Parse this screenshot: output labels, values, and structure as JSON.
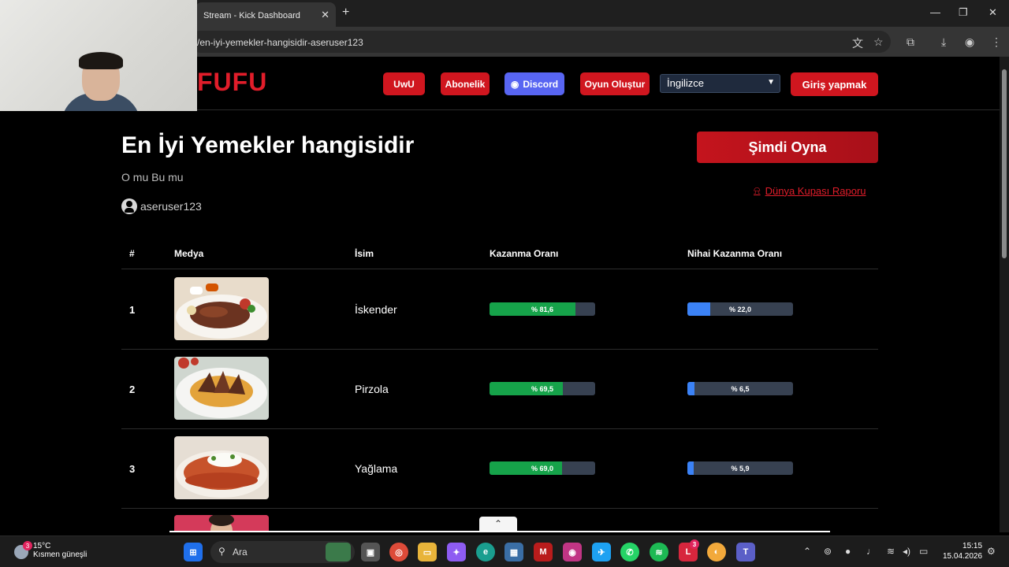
{
  "browser": {
    "tab_title": "Stream - Kick Dashboard",
    "tab_close": "✕",
    "new_tab": "+",
    "url": "/en-iyi-yemekler-hangisidir-aseruser123",
    "window_controls": [
      "—",
      "❐",
      "✕"
    ]
  },
  "nav": {
    "logo": "FUFU",
    "buttons": [
      "UwU",
      "Abonelik",
      "Discord",
      "Oyun Oluştur"
    ],
    "language": "İngilizce",
    "login": "Giriş yapmak"
  },
  "header": {
    "title": "En İyi Yemekler hangisidir",
    "subtitle": "O mu Bu mu",
    "author": "aseruser123",
    "play_button": "Şimdi Oyna",
    "report_link": "Dünya Kupası Raporu"
  },
  "table": {
    "columns": [
      "#",
      "Medya",
      "İsim",
      "Kazanma Oranı",
      "Nihai Kazanma Oranı"
    ],
    "rows": [
      {
        "rank": "1",
        "name": "İskender",
        "win_rate": 81.6,
        "win_label": "% 81,6",
        "final_rate": 22.0,
        "final_label": "% 22,0",
        "image": "iskender-plate"
      },
      {
        "rank": "2",
        "name": "Pirzola",
        "win_rate": 69.5,
        "win_label": "% 69,5",
        "final_rate": 6.5,
        "final_label": "% 6,5",
        "image": "lamb-chops-plate"
      },
      {
        "rank": "3",
        "name": "Yağlama",
        "win_rate": 69.0,
        "win_label": "% 69,0",
        "final_rate": 5.9,
        "final_label": "% 5,9",
        "image": "yaglama-plate"
      }
    ]
  },
  "colors": {
    "accent": "#d0161f",
    "win_bar": "#16a34a",
    "final_bar": "#3b82f6",
    "discord": "#5865f2"
  },
  "taskbar": {
    "temperature": "15°C",
    "weather": "Kısmen güneşli",
    "weather_badge": "3",
    "search": "Ara",
    "notification_badge": "3",
    "time": "15:15",
    "date": "15.04.2026"
  }
}
